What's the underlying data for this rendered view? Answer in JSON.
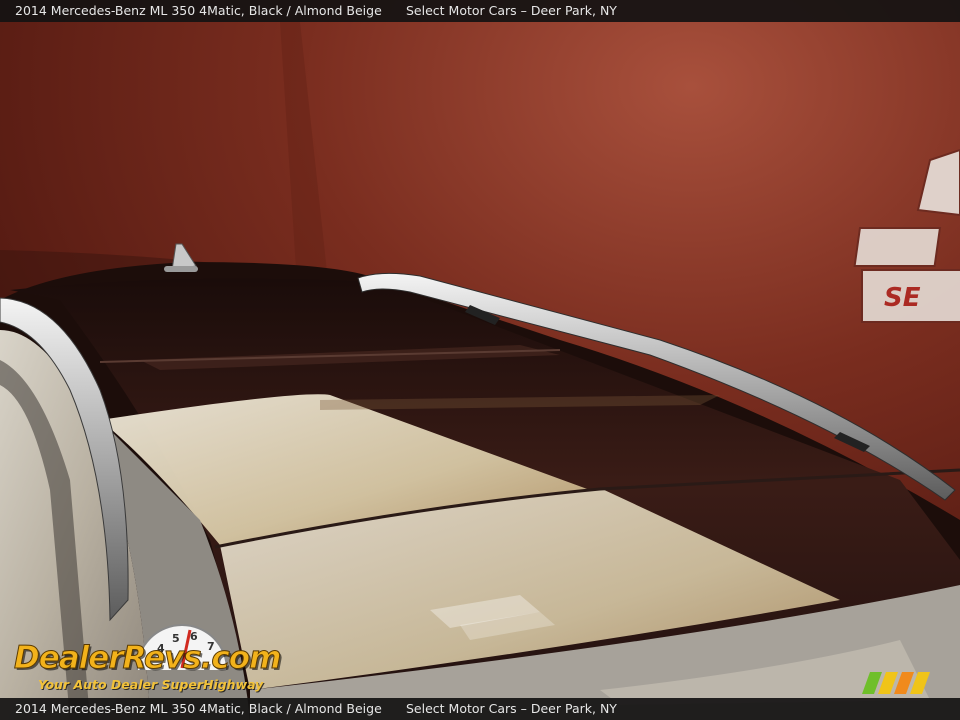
{
  "caption": {
    "car": "2014 Mercedes-Benz ML 350 4Matic,  Black / Almond Beige",
    "dealer": "Select Motor Cars – Deer Park, NY"
  },
  "watermark": {
    "brand": "DealerRevs.com",
    "tagline": "Your Auto Dealer SuperHighway",
    "gauge_numbers": [
      "4",
      "5",
      "6",
      "7"
    ]
  },
  "photo": {
    "subject": "vehicle roof with panoramic glass sunroof and roof rails",
    "wall_sign_fragment": "SE"
  },
  "colors": {
    "wall": "#7a2d1f",
    "roof_paint": "#b8b4ac",
    "glass": "#241412",
    "rail": "#d8d8d8",
    "caption_bg": "#141212",
    "logo_yellow": "#f2b21b",
    "logo_blue": "#3c6fd6"
  }
}
